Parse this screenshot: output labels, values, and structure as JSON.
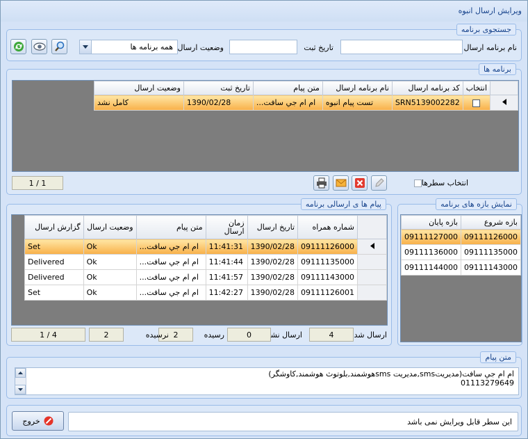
{
  "window": {
    "title": "ویرایش ارسال انبوه"
  },
  "search": {
    "legend": "جستجوی برنامه",
    "program_name_label": "نام برنامه ارسال",
    "program_name_value": "",
    "reg_date_label": "تاریخ ثبت",
    "reg_date_value": "",
    "status_label": "وضعیت ارسال",
    "status_selected": "همه برنامه ها"
  },
  "programs": {
    "legend": "برنامه ها",
    "columns": [
      "انتخاب",
      "کد برنامه ارسال",
      "نام برنامه ارسال",
      "متن پیام",
      "تاریخ ثبت",
      "وضعیت ارسال"
    ],
    "rows": [
      {
        "code": "SRN5139002282",
        "name": "تست پیام انبوه",
        "text": "ام ام جي سافت...",
        "date": "1390/02/28",
        "status": "کامل نشد"
      }
    ],
    "select_rows_label": "انتخاب سطرها",
    "pager": "1 / 1"
  },
  "messages": {
    "legend": "پیام ها ی ارسالی برنامه",
    "columns": [
      "شماره همراه",
      "تاریخ ارسال",
      "زمان ارسال",
      "متن پیام",
      "وضعیت ارسال",
      "گزارش ارسال"
    ],
    "rows": [
      {
        "mobile": "09111126000",
        "date": "1390/02/28",
        "time": "11:41:31",
        "text": "ام ام جي سافت...",
        "status": "Ok",
        "report": "Set"
      },
      {
        "mobile": "09111135000",
        "date": "1390/02/28",
        "time": "11:41:44",
        "text": "ام ام جي سافت...",
        "status": "Ok",
        "report": "Delivered"
      },
      {
        "mobile": "09111143000",
        "date": "1390/02/28",
        "time": "11:41:57",
        "text": "ام ام جي سافت...",
        "status": "Ok",
        "report": "Delivered"
      },
      {
        "mobile": "09111126001",
        "date": "1390/02/28",
        "time": "11:42:27",
        "text": "ام ام جي سافت...",
        "status": "Ok",
        "report": "Set"
      }
    ],
    "sent_label": "ارسال شده",
    "sent_value": "4",
    "unsent_label": "ارسال نشده",
    "unsent_value": "0",
    "delivered_label": "رسیده",
    "delivered_value": "2",
    "undelivered_label": "نرسیده",
    "undelivered_value": "2",
    "pager": "1 / 4"
  },
  "ranges": {
    "legend": "نمایش بازه های برنامه",
    "columns": [
      "بازه شروع",
      "بازه پایان"
    ],
    "rows": [
      {
        "start": "09111126000",
        "end": "09111127000"
      },
      {
        "start": "09111135000",
        "end": "09111136000"
      },
      {
        "start": "09111143000",
        "end": "09111144000"
      }
    ]
  },
  "message_text": {
    "legend": "متن پیام",
    "line1": "ام ام جي سافت(مدیریتsms,مدیریت smsهوشمند,بلوتوث هوشمند,کاوشگر)",
    "line2": "01113279649"
  },
  "footer": {
    "notice": "این سطر قابل ویرایش نمی باشد",
    "exit_label": "خروج"
  }
}
